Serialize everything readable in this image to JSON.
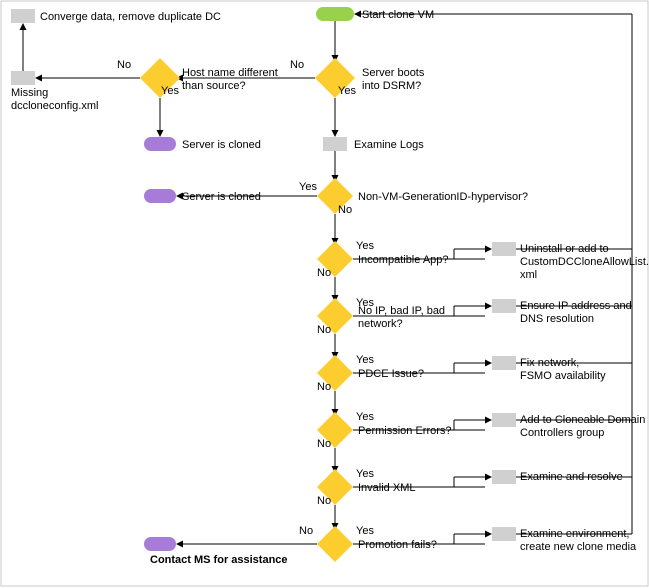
{
  "start": "Start clone VM",
  "d_dsrm": "Server boots\ninto DSRM?",
  "d_host": "Host name different\nthan source?",
  "a_conv": "Converge data, remove duplicate DC",
  "a_miss": "Missing\ndccloneconfig.xml",
  "t_cloned1": "Server is cloned",
  "t_cloned2": "Server is cloned",
  "a_logs": "Examine Logs",
  "d_hyp": "Non-VM-GenerationID-hypervisor?",
  "d_app": "Incompatible App?",
  "r_app": "Uninstall or add to\nCustomDCCloneAllowList.\nxml",
  "d_ip": "No IP, bad IP, bad\nnetwork?",
  "r_ip": "Ensure IP address and\nDNS resolution",
  "d_pdce": "PDCE Issue?",
  "r_pdce": "Fix network,\nFSMO availability",
  "d_perm": "Permission Errors?",
  "r_perm": "Add to Cloneable Domain\nControllers group",
  "d_xml": "Invalid XML",
  "r_xml": "Examine and resolve",
  "d_prom": "Promotion fails?",
  "r_prom": "Examine environment,\ncreate new clone media",
  "t_ms": "Contact MS for assistance",
  "yes": "Yes",
  "no": "No"
}
